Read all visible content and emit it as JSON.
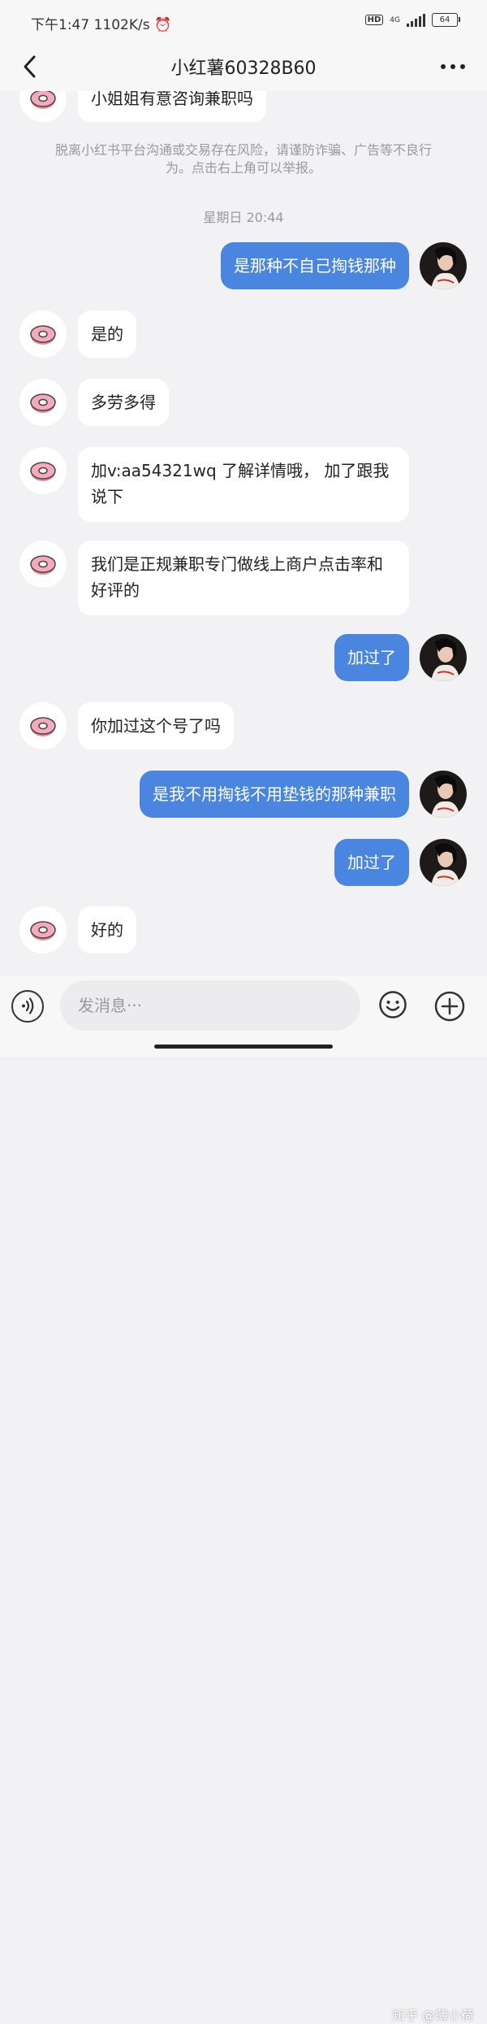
{
  "status": {
    "left": "下午1:47",
    "speed": "1102K/s",
    "hd": "HD",
    "network": "4G",
    "battery": "64"
  },
  "header": {
    "title": "小红薯60328B60",
    "back_icon": "chevron-left-icon",
    "more_icon": "more-dots-icon"
  },
  "chat": {
    "notice": "脱离小红书平台沟通或交易存在风险，请谨防诈骗、广告等不良行为。点击右上角可以举报。",
    "timestamp": "星期日 20:44",
    "messages": [
      {
        "side": "in",
        "text": "小姐姐有意咨询兼职吗"
      },
      {
        "side": "out",
        "text": "是那种不自己掏钱那种"
      },
      {
        "side": "in",
        "text": "是的"
      },
      {
        "side": "in",
        "text": "多劳多得"
      },
      {
        "side": "in",
        "text": "加v:aa54321wq 了解详情哦， 加了跟我说下"
      },
      {
        "side": "in",
        "text": "我们是正规兼职专门做线上商户点击率和好评的"
      },
      {
        "side": "out",
        "text": "加过了"
      },
      {
        "side": "in",
        "text": "你加过这个号了吗"
      },
      {
        "side": "out",
        "text": "是我不用掏钱不用垫钱的那种兼职"
      },
      {
        "side": "out",
        "text": "加过了"
      },
      {
        "side": "in",
        "text": "好的"
      }
    ]
  },
  "input": {
    "placeholder": "发消息···",
    "voice_icon": "voice-icon",
    "emoji_icon": "emoji-icon",
    "plus_icon": "plus-icon"
  },
  "watermark": "知乎 @薄小荷",
  "colors": {
    "outgoing_bubble": "#4a86e0",
    "incoming_bubble": "#ffffff",
    "background": "#f2f2f4"
  }
}
